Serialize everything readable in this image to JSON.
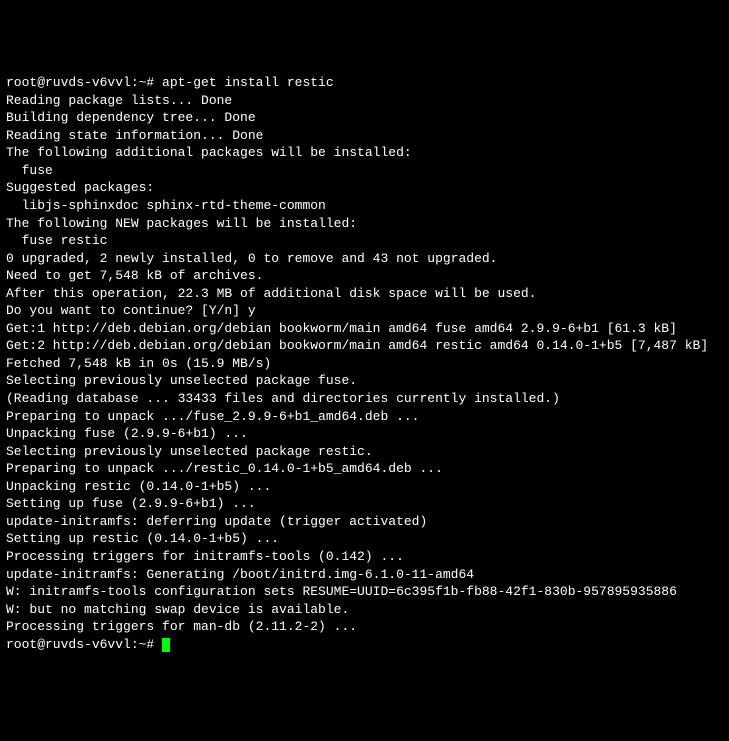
{
  "terminal": {
    "prompt1": "root@ruvds-v6vvl:~# ",
    "command1": "apt-get install restic",
    "lines": [
      "Reading package lists... Done",
      "Building dependency tree... Done",
      "Reading state information... Done",
      "The following additional packages will be installed:",
      "  fuse",
      "Suggested packages:",
      "  libjs-sphinxdoc sphinx-rtd-theme-common",
      "The following NEW packages will be installed:",
      "  fuse restic",
      "0 upgraded, 2 newly installed, 0 to remove and 43 not upgraded.",
      "Need to get 7,548 kB of archives.",
      "After this operation, 22.3 MB of additional disk space will be used.",
      "Do you want to continue? [Y/n] y",
      "Get:1 http://deb.debian.org/debian bookworm/main amd64 fuse amd64 2.9.9-6+b1 [61.3 kB]",
      "Get:2 http://deb.debian.org/debian bookworm/main amd64 restic amd64 0.14.0-1+b5 [7,487 kB]",
      "Fetched 7,548 kB in 0s (15.9 MB/s)",
      "Selecting previously unselected package fuse.",
      "(Reading database ... 33433 files and directories currently installed.)",
      "Preparing to unpack .../fuse_2.9.9-6+b1_amd64.deb ...",
      "Unpacking fuse (2.9.9-6+b1) ...",
      "Selecting previously unselected package restic.",
      "Preparing to unpack .../restic_0.14.0-1+b5_amd64.deb ...",
      "Unpacking restic (0.14.0-1+b5) ...",
      "Setting up fuse (2.9.9-6+b1) ...",
      "update-initramfs: deferring update (trigger activated)",
      "Setting up restic (0.14.0-1+b5) ...",
      "Processing triggers for initramfs-tools (0.142) ...",
      "update-initramfs: Generating /boot/initrd.img-6.1.0-11-amd64",
      "W: initramfs-tools configuration sets RESUME=UUID=6c395f1b-fb88-42f1-830b-957895935886",
      "W: but no matching swap device is available.",
      "Processing triggers for man-db (2.11.2-2) ..."
    ],
    "prompt2": "root@ruvds-v6vvl:~# "
  }
}
